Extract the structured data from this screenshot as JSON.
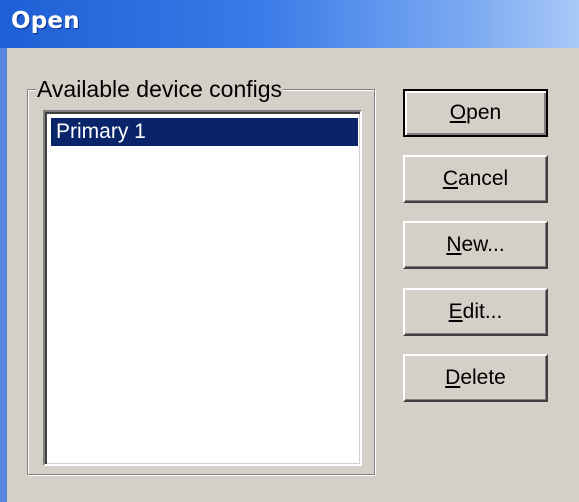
{
  "window": {
    "title": "Open"
  },
  "group": {
    "label": "Available device configs"
  },
  "list": {
    "items": [
      {
        "label": "Primary 1",
        "selected": true
      }
    ]
  },
  "buttons": {
    "open": {
      "mnemonic": "O",
      "rest": "pen"
    },
    "cancel": {
      "mnemonic": "C",
      "rest": "ancel"
    },
    "new": {
      "mnemonic": "N",
      "rest": "ew..."
    },
    "edit": {
      "mnemonic": "E",
      "rest": "dit..."
    },
    "delete": {
      "mnemonic": "D",
      "rest": "elete"
    }
  },
  "colors": {
    "titlebar": "#1f5fd6",
    "face": "#d4d0c8",
    "selection": "#0a246a"
  }
}
